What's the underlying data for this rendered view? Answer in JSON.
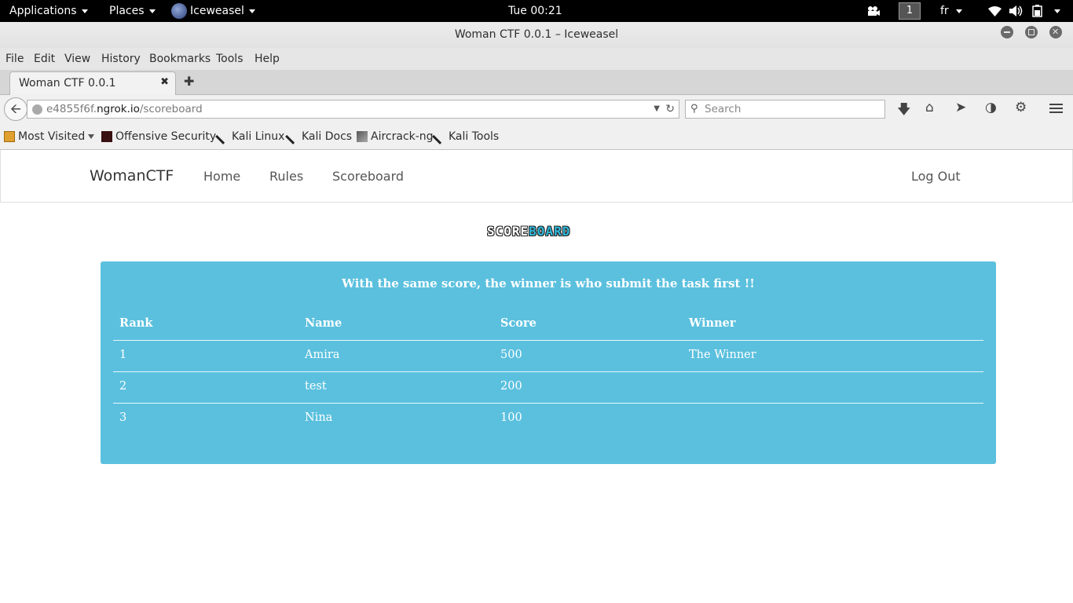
{
  "topbar": {
    "applications": "Applications",
    "places": "Places",
    "app_name": "Iceweasel",
    "clock": "Tue 00:21",
    "workspace": "1",
    "lang": "fr"
  },
  "window": {
    "title": "Woman CTF 0.0.1 – Iceweasel"
  },
  "menu": {
    "file": "File",
    "edit": "Edit",
    "view": "View",
    "history": "History",
    "bookmarks": "Bookmarks",
    "tools": "Tools",
    "help": "Help"
  },
  "tab": {
    "label": "Woman CTF 0.0.1"
  },
  "url": {
    "prefix": "e4855f6f.",
    "host": "ngrok.io",
    "path": "/scoreboard",
    "search_placeholder": "Search"
  },
  "bookmarks": {
    "most_visited": "Most Visited",
    "offsec": "Offensive Security",
    "kali_linux": "Kali Linux",
    "kali_docs": "Kali Docs",
    "aircrack": "Aircrack-ng",
    "kali_tools": "Kali Tools"
  },
  "site": {
    "brand": "WomanCTF",
    "nav_home": "Home",
    "nav_rules": "Rules",
    "nav_scoreboard": "Scoreboard",
    "logout": "Log Out",
    "logo_part1": "SCORE",
    "logo_part2": "BOARD"
  },
  "scoreboard": {
    "notice": "With the same score, the winner is who submit the task first !!",
    "headers": {
      "rank": "Rank",
      "name": "Name",
      "score": "Score",
      "winner": "Winner"
    },
    "rows": [
      {
        "rank": "1",
        "name": "Amira",
        "score": "500",
        "winner": "The Winner"
      },
      {
        "rank": "2",
        "name": "test",
        "score": "200",
        "winner": ""
      },
      {
        "rank": "3",
        "name": "Nina",
        "score": "100",
        "winner": ""
      }
    ]
  },
  "colors": {
    "panel": "#5bc0de",
    "topbar": "#000000",
    "logo_accent": "#2fb7d8"
  }
}
